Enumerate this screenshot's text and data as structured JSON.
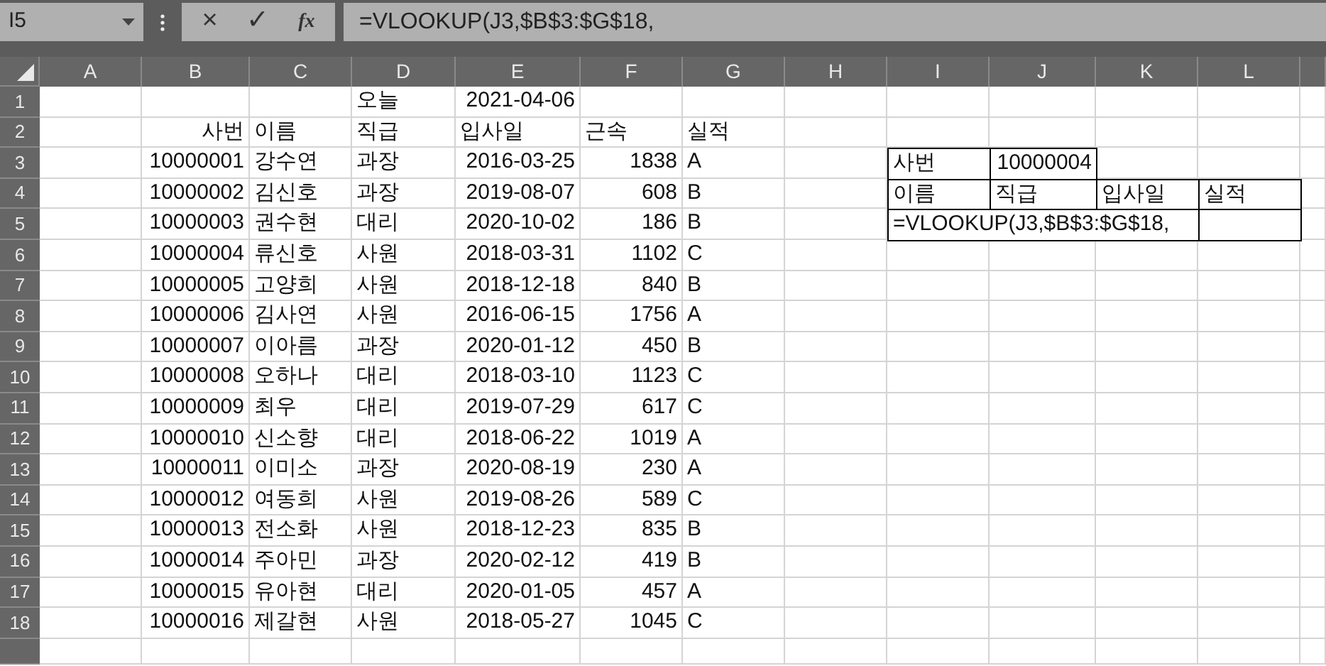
{
  "name_box": "I5",
  "formula_bar": {
    "buttons": [
      "×",
      "✓",
      "fx"
    ],
    "value": "=VLOOKUP(J3,$B$3:$G$18,"
  },
  "columns": [
    "A",
    "B",
    "C",
    "D",
    "E",
    "F",
    "G",
    "H",
    "I",
    "J",
    "K",
    "L"
  ],
  "rows": [
    {
      "number": "1",
      "cells": {
        "D": {
          "text": "오늘",
          "kind": "text"
        },
        "E": {
          "text": "2021-04-06",
          "kind": "number"
        }
      }
    },
    {
      "number": "2",
      "cells": {
        "B": {
          "text": "사번",
          "kind": "number"
        },
        "C": {
          "text": "이름",
          "kind": "text"
        },
        "D": {
          "text": "직급",
          "kind": "text"
        },
        "E": {
          "text": "입사일",
          "kind": "text"
        },
        "F": {
          "text": "근속",
          "kind": "text"
        },
        "G": {
          "text": "실적",
          "kind": "text"
        }
      }
    },
    {
      "number": "3",
      "cells": {
        "B": {
          "text": "10000001",
          "kind": "number"
        },
        "C": {
          "text": "강수연",
          "kind": "text"
        },
        "D": {
          "text": "과장",
          "kind": "text"
        },
        "E": {
          "text": "2016-03-25",
          "kind": "number"
        },
        "F": {
          "text": "1838",
          "kind": "number"
        },
        "G": {
          "text": "A",
          "kind": "text"
        },
        "I": {
          "text": "사번",
          "kind": "boxed"
        },
        "J": {
          "text": "10000004",
          "kind": "boxed-number"
        }
      }
    },
    {
      "number": "4",
      "cells": {
        "B": {
          "text": "10000002",
          "kind": "number"
        },
        "C": {
          "text": "김신호",
          "kind": "text"
        },
        "D": {
          "text": "과장",
          "kind": "text"
        },
        "E": {
          "text": "2019-08-07",
          "kind": "number"
        },
        "F": {
          "text": "608",
          "kind": "number"
        },
        "G": {
          "text": "B",
          "kind": "text"
        },
        "I": {
          "text": "이름",
          "kind": "boxed"
        },
        "J": {
          "text": "직급",
          "kind": "boxed"
        },
        "K": {
          "text": "입사일",
          "kind": "boxed"
        },
        "L": {
          "text": "실적",
          "kind": "boxed"
        }
      }
    },
    {
      "number": "5",
      "cells": {
        "B": {
          "text": "10000003",
          "kind": "number"
        },
        "C": {
          "text": "권수현",
          "kind": "text"
        },
        "D": {
          "text": "대리",
          "kind": "text"
        },
        "E": {
          "text": "2020-10-02",
          "kind": "number"
        },
        "F": {
          "text": "186",
          "kind": "number"
        },
        "G": {
          "text": "B",
          "kind": "text"
        },
        "I": {
          "text": "=VLOOKUP(J3,$B$3:$G$18,",
          "kind": "editing"
        },
        "L": {
          "kind": "boxed"
        }
      }
    },
    {
      "number": "6",
      "cells": {
        "B": {
          "text": "10000004",
          "kind": "number"
        },
        "C": {
          "text": "류신호",
          "kind": "text"
        },
        "D": {
          "text": "사원",
          "kind": "text"
        },
        "E": {
          "text": "2018-03-31",
          "kind": "number"
        },
        "F": {
          "text": "1102",
          "kind": "number"
        },
        "G": {
          "text": "C",
          "kind": "text"
        }
      }
    },
    {
      "number": "7",
      "cells": {
        "B": {
          "text": "10000005",
          "kind": "number"
        },
        "C": {
          "text": "고양희",
          "kind": "text"
        },
        "D": {
          "text": "사원",
          "kind": "text"
        },
        "E": {
          "text": "2018-12-18",
          "kind": "number"
        },
        "F": {
          "text": "840",
          "kind": "number"
        },
        "G": {
          "text": "B",
          "kind": "text"
        }
      }
    },
    {
      "number": "8",
      "cells": {
        "B": {
          "text": "10000006",
          "kind": "number"
        },
        "C": {
          "text": "김사연",
          "kind": "text"
        },
        "D": {
          "text": "사원",
          "kind": "text"
        },
        "E": {
          "text": "2016-06-15",
          "kind": "number"
        },
        "F": {
          "text": "1756",
          "kind": "number"
        },
        "G": {
          "text": "A",
          "kind": "text"
        }
      }
    },
    {
      "number": "9",
      "cells": {
        "B": {
          "text": "10000007",
          "kind": "number"
        },
        "C": {
          "text": "이아름",
          "kind": "text"
        },
        "D": {
          "text": "과장",
          "kind": "text"
        },
        "E": {
          "text": "2020-01-12",
          "kind": "number"
        },
        "F": {
          "text": "450",
          "kind": "number"
        },
        "G": {
          "text": "B",
          "kind": "text"
        }
      }
    },
    {
      "number": "10",
      "cells": {
        "B": {
          "text": "10000008",
          "kind": "number"
        },
        "C": {
          "text": "오하나",
          "kind": "text"
        },
        "D": {
          "text": "대리",
          "kind": "text"
        },
        "E": {
          "text": "2018-03-10",
          "kind": "number"
        },
        "F": {
          "text": "1123",
          "kind": "number"
        },
        "G": {
          "text": "C",
          "kind": "text"
        }
      }
    },
    {
      "number": "11",
      "cells": {
        "B": {
          "text": "10000009",
          "kind": "number"
        },
        "C": {
          "text": "최우",
          "kind": "text"
        },
        "D": {
          "text": "대리",
          "kind": "text"
        },
        "E": {
          "text": "2019-07-29",
          "kind": "number"
        },
        "F": {
          "text": "617",
          "kind": "number"
        },
        "G": {
          "text": "C",
          "kind": "text"
        }
      }
    },
    {
      "number": "12",
      "cells": {
        "B": {
          "text": "10000010",
          "kind": "number"
        },
        "C": {
          "text": "신소향",
          "kind": "text"
        },
        "D": {
          "text": "대리",
          "kind": "text"
        },
        "E": {
          "text": "2018-06-22",
          "kind": "number"
        },
        "F": {
          "text": "1019",
          "kind": "number"
        },
        "G": {
          "text": "A",
          "kind": "text"
        }
      }
    },
    {
      "number": "13",
      "cells": {
        "B": {
          "text": "10000011",
          "kind": "number"
        },
        "C": {
          "text": "이미소",
          "kind": "text"
        },
        "D": {
          "text": "과장",
          "kind": "text"
        },
        "E": {
          "text": "2020-08-19",
          "kind": "number"
        },
        "F": {
          "text": "230",
          "kind": "number"
        },
        "G": {
          "text": "A",
          "kind": "text"
        }
      }
    },
    {
      "number": "14",
      "cells": {
        "B": {
          "text": "10000012",
          "kind": "number"
        },
        "C": {
          "text": "여동희",
          "kind": "text"
        },
        "D": {
          "text": "사원",
          "kind": "text"
        },
        "E": {
          "text": "2019-08-26",
          "kind": "number"
        },
        "F": {
          "text": "589",
          "kind": "number"
        },
        "G": {
          "text": "C",
          "kind": "text"
        }
      }
    },
    {
      "number": "15",
      "cells": {
        "B": {
          "text": "10000013",
          "kind": "number"
        },
        "C": {
          "text": "전소화",
          "kind": "text"
        },
        "D": {
          "text": "사원",
          "kind": "text"
        },
        "E": {
          "text": "2018-12-23",
          "kind": "number"
        },
        "F": {
          "text": "835",
          "kind": "number"
        },
        "G": {
          "text": "B",
          "kind": "text"
        }
      }
    },
    {
      "number": "16",
      "cells": {
        "B": {
          "text": "10000014",
          "kind": "number"
        },
        "C": {
          "text": "주아민",
          "kind": "text"
        },
        "D": {
          "text": "과장",
          "kind": "text"
        },
        "E": {
          "text": "2020-02-12",
          "kind": "number"
        },
        "F": {
          "text": "419",
          "kind": "number"
        },
        "G": {
          "text": "B",
          "kind": "text"
        }
      }
    },
    {
      "number": "17",
      "cells": {
        "B": {
          "text": "10000015",
          "kind": "number"
        },
        "C": {
          "text": "유아현",
          "kind": "text"
        },
        "D": {
          "text": "대리",
          "kind": "text"
        },
        "E": {
          "text": "2020-01-05",
          "kind": "number"
        },
        "F": {
          "text": "457",
          "kind": "number"
        },
        "G": {
          "text": "A",
          "kind": "text"
        }
      }
    },
    {
      "number": "18",
      "cells": {
        "B": {
          "text": "10000016",
          "kind": "number"
        },
        "C": {
          "text": "제갈현",
          "kind": "text"
        },
        "D": {
          "text": "사원",
          "kind": "text"
        },
        "E": {
          "text": "2018-05-27",
          "kind": "number"
        },
        "F": {
          "text": "1045",
          "kind": "number"
        },
        "G": {
          "text": "C",
          "kind": "text"
        }
      }
    }
  ]
}
